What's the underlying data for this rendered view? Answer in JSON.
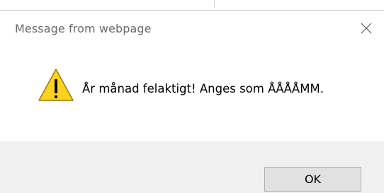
{
  "dialog": {
    "title": "Message from webpage",
    "message": "År månad felaktigt! Anges som ÅÅÅÅMM.",
    "ok_label": "OK",
    "icon": "warning-icon",
    "close_icon": "close-icon"
  },
  "colors": {
    "dialog_bg": "#ffffff",
    "footer_bg": "#f0f0f0",
    "title_text": "#6b6b6b",
    "button_bg": "#e1e1e1",
    "button_border": "#adadad",
    "warning_fill": "#ffd21f",
    "warning_stroke": "#9c7a00"
  }
}
